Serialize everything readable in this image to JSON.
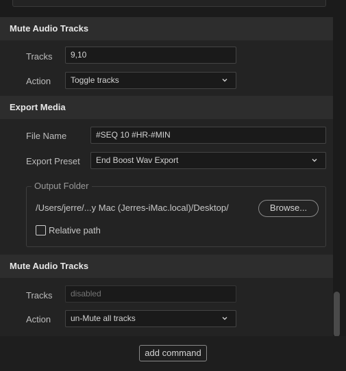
{
  "sections": [
    {
      "title": "Mute Audio Tracks",
      "tracks_label": "Tracks",
      "tracks_value": "9,10",
      "action_label": "Action",
      "action_value": "Toggle tracks"
    },
    {
      "title": "Export Media",
      "file_name_label": "File Name",
      "file_name_value": "#SEQ 10 #HR-#MIN",
      "export_preset_label": "Export Preset",
      "export_preset_value": "End Boost Wav Export",
      "output_folder_legend": "Output Folder",
      "output_folder_path": "/Users/jerre/...y Mac (Jerres-iMac.local)/Desktop/",
      "browse_label": "Browse...",
      "relative_path_label": "Relative path",
      "relative_path_checked": false
    },
    {
      "title": "Mute Audio Tracks",
      "tracks_label": "Tracks",
      "tracks_placeholder": "disabled",
      "action_label": "Action",
      "action_value": "un-Mute all tracks"
    }
  ],
  "add_command_label": "add command",
  "icons": {
    "dropdown": "chevron-down-icon"
  },
  "colors": {
    "background": "#1b1b1b",
    "header": "#2d2d2d",
    "panel": "#232323"
  }
}
